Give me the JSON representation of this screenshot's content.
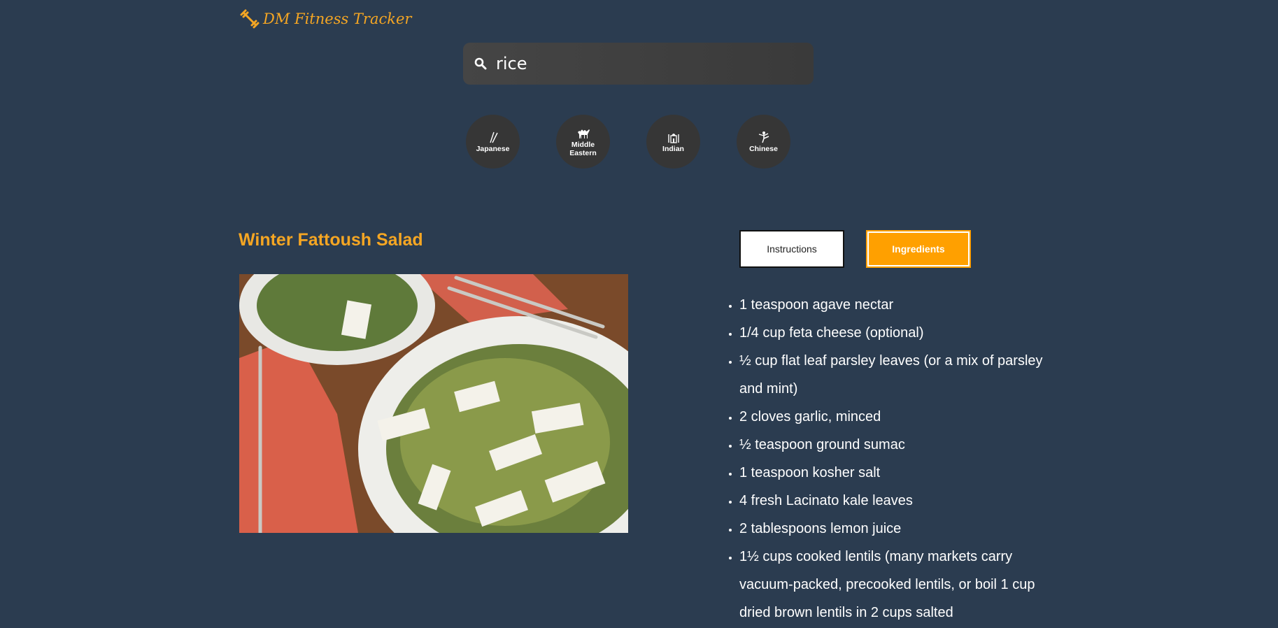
{
  "brand": {
    "name": "DM Fitness Tracker",
    "icon": "dumbbell-icon",
    "color": "#f5a623"
  },
  "search": {
    "icon": "search-icon",
    "value": "rice"
  },
  "cuisines": [
    {
      "label": "Japanese",
      "icon": "chopsticks-icon"
    },
    {
      "label": "Middle Eastern",
      "icon": "camel-icon"
    },
    {
      "label": "Indian",
      "icon": "taj-mahal-icon"
    },
    {
      "label": "Chinese",
      "icon": "kung-fu-icon"
    }
  ],
  "recipe": {
    "title": "Winter Fattoush Salad"
  },
  "tabs": {
    "instructions": "Instructions",
    "ingredients": "Ingredients",
    "active": "ingredients"
  },
  "ingredients": [
    "1 teaspoon agave nectar",
    "1/4 cup feta cheese (optional)",
    "½ cup flat leaf parsley leaves (or a mix of parsley and mint)",
    "2 cloves garlic, minced",
    "½ teaspoon ground sumac",
    "1 teaspoon kosher salt",
    "4 fresh Lacinato kale leaves",
    "2 tablespoons lemon juice",
    "1½ cups cooked lentils (many markets carry vacuum-packed, precooked lentils, or boil 1 cup dried brown lentils in 2 cups salted"
  ],
  "colors": {
    "background": "#2b3c50",
    "accent": "#ffa000",
    "title": "#f5a623"
  }
}
